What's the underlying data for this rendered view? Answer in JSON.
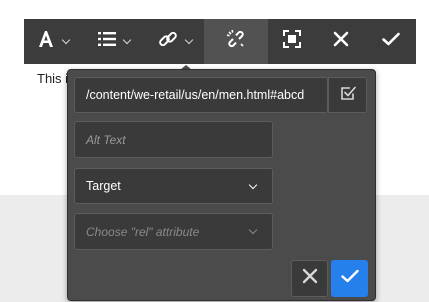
{
  "page": {
    "under_text": "This i"
  },
  "toolbar": {
    "items": [
      {
        "name": "format-text",
        "icon": "text-format-icon",
        "has_dropdown": true
      },
      {
        "name": "list",
        "icon": "list-icon",
        "has_dropdown": true
      },
      {
        "name": "link",
        "icon": "link-icon",
        "has_dropdown": true
      },
      {
        "name": "unlink",
        "icon": "unlink-icon",
        "active": true
      },
      {
        "name": "fullscreen",
        "icon": "fullscreen-icon"
      },
      {
        "name": "close",
        "icon": "close-icon"
      },
      {
        "name": "confirm",
        "icon": "checkmark-icon"
      }
    ]
  },
  "link_dialog": {
    "path_value": "/content/we-retail/us/en/men.html#abcd",
    "path_picker_icon": "checkbox-check-icon",
    "alt_text_placeholder": "Alt Text",
    "target_value": "Target",
    "rel_placeholder": "Choose \"rel\" attribute",
    "cancel_icon": "close-icon",
    "apply_icon": "checkmark-icon"
  },
  "colors": {
    "toolbar_bg": "#3c3c3c",
    "dialog_bg": "#4b4b4b",
    "accent": "#2680eb"
  }
}
